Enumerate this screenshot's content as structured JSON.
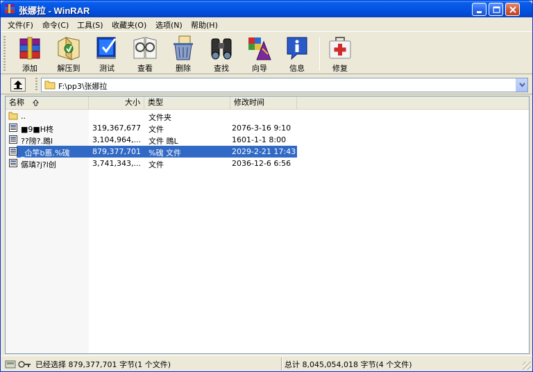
{
  "window": {
    "title": "张娜拉 - WinRAR",
    "icon": "winrar-app-icon"
  },
  "menu": [
    {
      "label": "文件(F)"
    },
    {
      "label": "命令(C)"
    },
    {
      "label": "工具(S)"
    },
    {
      "label": "收藏夹(O)"
    },
    {
      "label": "选项(N)"
    },
    {
      "label": "帮助(H)"
    }
  ],
  "toolbar": [
    {
      "label": "添加",
      "icon": "add-icon"
    },
    {
      "label": "解压到",
      "icon": "extract-icon"
    },
    {
      "label": "测试",
      "icon": "test-icon"
    },
    {
      "label": "查看",
      "icon": "view-icon"
    },
    {
      "label": "删除",
      "icon": "delete-icon"
    },
    {
      "label": "查找",
      "icon": "find-icon"
    },
    {
      "label": "向导",
      "icon": "wizard-icon"
    },
    {
      "label": "信息",
      "icon": "info-icon"
    },
    {
      "label": "修复",
      "icon": "repair-icon"
    }
  ],
  "address": {
    "path": "F:\\pp3\\张娜拉"
  },
  "columns": {
    "name": "名称",
    "size": "大小",
    "type": "类型",
    "modified": "修改时间"
  },
  "files": [
    {
      "name": "..",
      "size": "",
      "type": "文件夹",
      "modified": "",
      "icon": "folder-icon"
    },
    {
      "name": "■9■H柊",
      "size": "319,367,677",
      "type": "文件",
      "modified": "2076-3-16 9:10",
      "icon": "file-icon"
    },
    {
      "name": "??䧛?.鵖l",
      "size": "3,104,964,...",
      "type": "文件 鵖L",
      "modified": "1601-1-1 8:00",
      "icon": "file-icon"
    },
    {
      "name": "_仚竿b慝.%磈",
      "size": "879,377,701",
      "type": "%磈 文件",
      "modified": "2029-2-21 17:43",
      "icon": "file-icon"
    },
    {
      "name": "僝瑱?j?l创",
      "size": "3,741,343,...",
      "type": "文件",
      "modified": "2036-12-6 6:56",
      "icon": "file-icon"
    }
  ],
  "selected_index": 3,
  "status": {
    "left": "已经选择 879,377,701 字节(1 个文件)",
    "right": "总计 8,045,054,018 字节(4 个文件)"
  }
}
